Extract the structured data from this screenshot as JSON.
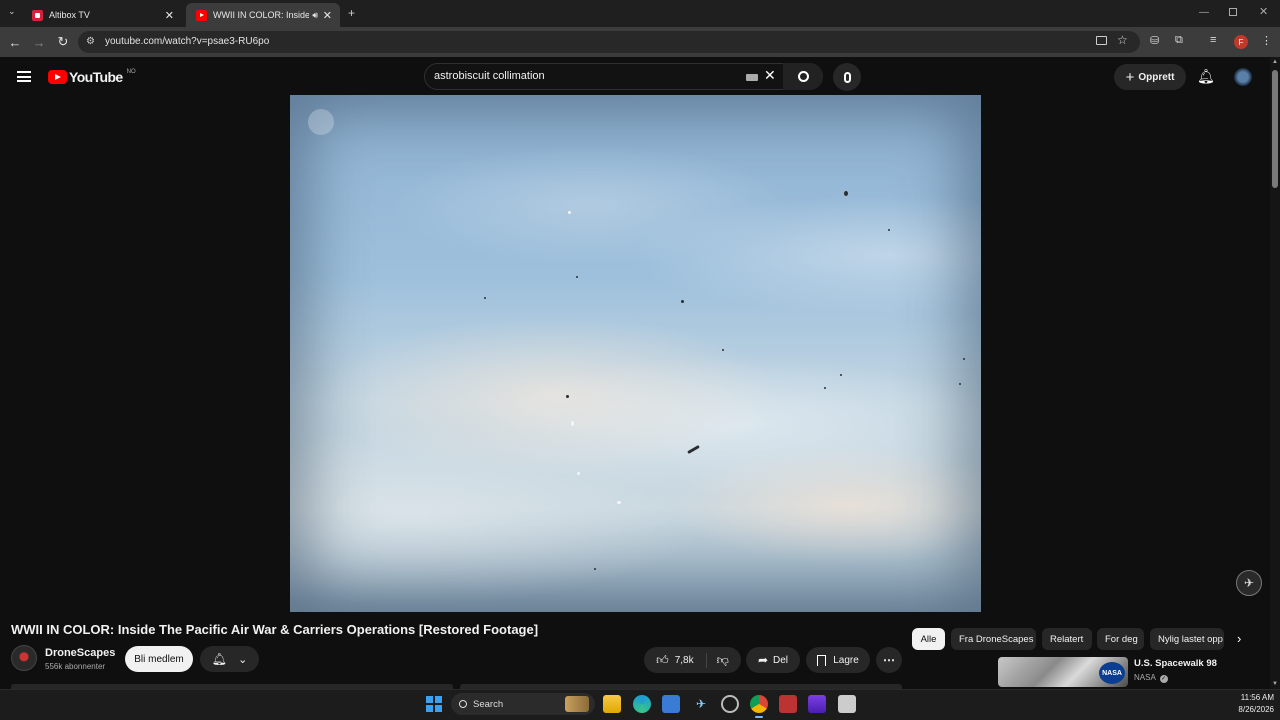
{
  "browser": {
    "tabs": [
      {
        "title": "Altibox TV",
        "active": false
      },
      {
        "title": "WWII IN COLOR: Inside The",
        "active": true
      }
    ],
    "url": "youtube.com/watch?v=psae3-RU6po",
    "profile_initial": "F"
  },
  "youtube": {
    "logo": "YouTube",
    "region": "NO",
    "search_value": "astrobiscuit collimation",
    "create_label": "Opprett"
  },
  "video": {
    "title": "WWII IN COLOR: Inside The Pacific Air War & Carriers Operations [Restored Footage]",
    "channel": "DroneScapes",
    "subscribers": "556k abonnenter",
    "join_label": "Bli medlem",
    "likes": "7,8k",
    "share_label": "Del",
    "save_label": "Lagre"
  },
  "chips": [
    "Alle",
    "Fra DroneScapes",
    "Relatert",
    "For deg",
    "Nylig lastet opp"
  ],
  "suggestion": {
    "title": "U.S. Spacewalk 98",
    "channel": "NASA",
    "badge": "NASA"
  },
  "taskbar": {
    "search_label": "Search",
    "time": "11:56 AM",
    "date": "8/26/2026"
  }
}
